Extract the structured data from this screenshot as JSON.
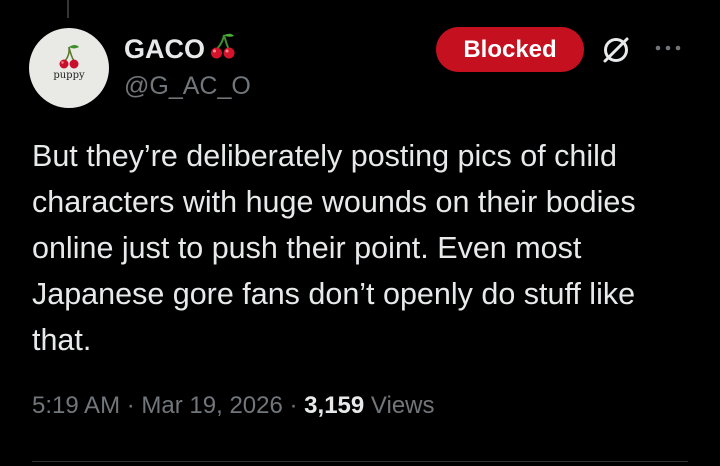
{
  "author": {
    "display_name": "GACO",
    "name_emoji": "cherry-icon",
    "handle": "@G_AC_O",
    "avatar_text": "puppy"
  },
  "actions": {
    "blocked_label": "Blocked",
    "grok_icon": "grok-icon",
    "more_icon": "more-horizontal-icon"
  },
  "tweet": {
    "text": "But they’re deliberately posting pics of child characters with huge wounds on their bodies online just to push their point. Even most Japanese gore fans don’t openly do stuff like that."
  },
  "meta": {
    "time": "5:19 AM",
    "separator_1": "·",
    "date": "Mar 19, 2026",
    "separator_2": "·",
    "views_count": "3,159",
    "views_label": "Views"
  },
  "colors": {
    "background": "#000000",
    "text_primary": "#e7e9ea",
    "text_secondary": "#71767b",
    "blocked_button": "#c4101f",
    "divider": "#2f3336"
  }
}
